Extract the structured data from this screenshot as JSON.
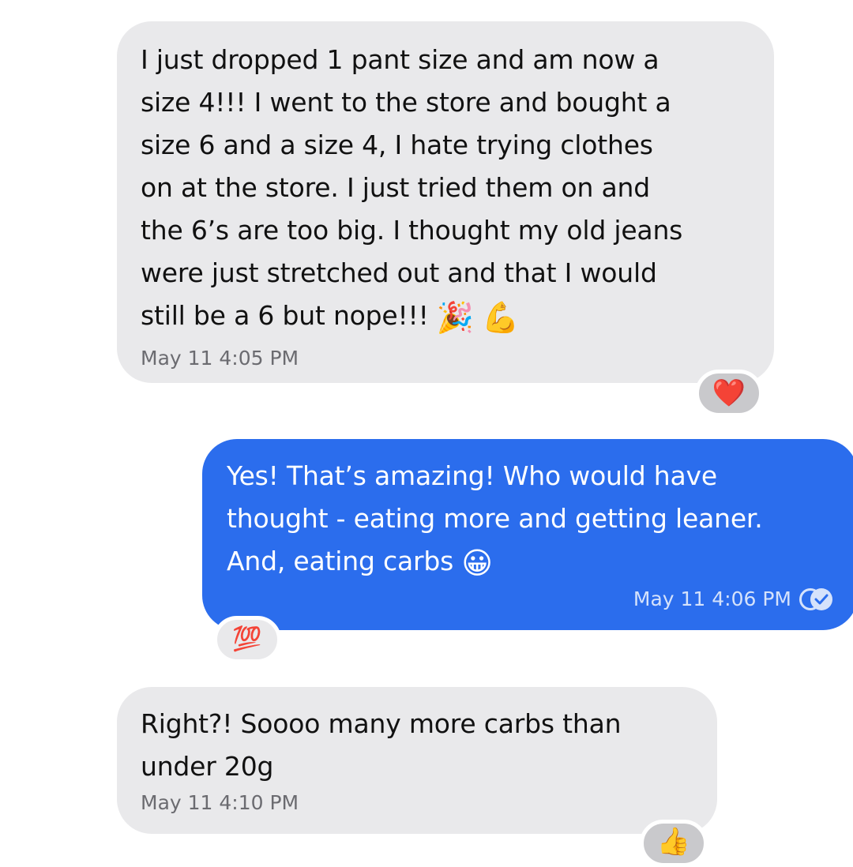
{
  "messages": [
    {
      "direction": "incoming",
      "lines": [
        "I just dropped 1 pant size and am now a",
        "size 4!!! I went to the store and bought a",
        "size 6 and a size 4, I hate trying clothes",
        "on at the store. I just tried them on and",
        "the 6’s are too big. I thought my old jeans",
        "were just stretched out and that I would",
        "still be a 6 but nope!!!"
      ],
      "emojis": [
        "🎉",
        "💪"
      ],
      "timestamp": "May 11 4:05 PM",
      "reaction": "❤️"
    },
    {
      "direction": "outgoing",
      "lines": [
        "Yes! That’s amazing! Who would have",
        "thought - eating more and getting leaner.",
        "And, eating carbs"
      ],
      "emojis": [
        "😀"
      ],
      "timestamp": "May 11 4:06 PM",
      "status_icon": "read-check-icon",
      "reaction": "💯"
    },
    {
      "direction": "incoming",
      "lines": [
        "Right?! Soooo many more carbs than",
        "under 20g"
      ],
      "timestamp": "May 11 4:10 PM",
      "reaction": "👍"
    }
  ],
  "colors": {
    "incoming_bubble": "#e9e9eb",
    "outgoing_bubble": "#2b6ded",
    "incoming_timestamp": "#6b6b70",
    "outgoing_timestamp": "#d5e2fb"
  }
}
